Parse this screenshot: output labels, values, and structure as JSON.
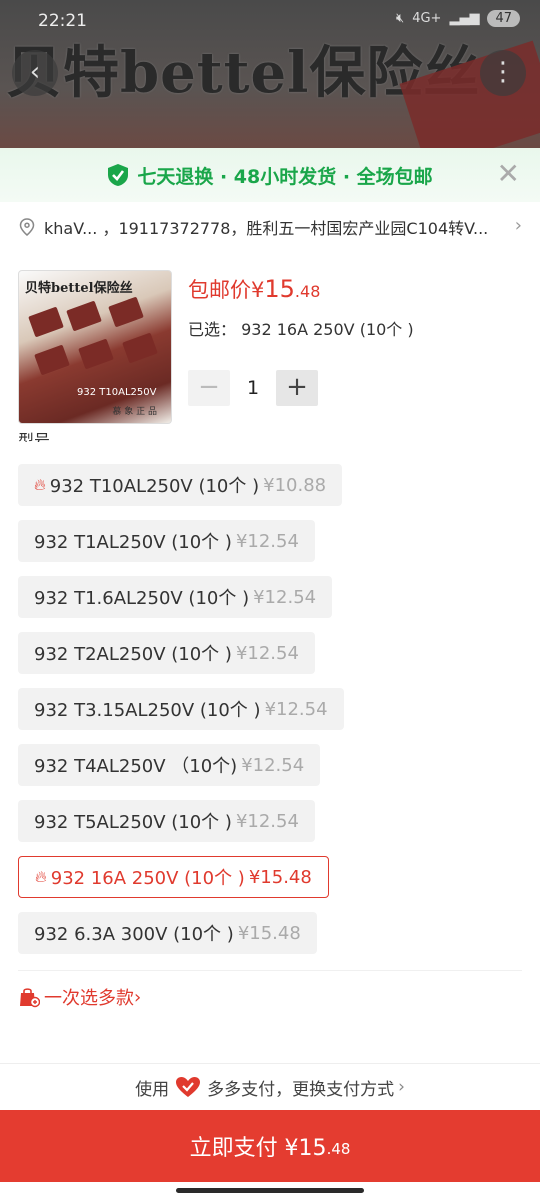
{
  "status_bar": {
    "time": "22:21",
    "signal": "4G+",
    "battery": "47"
  },
  "background": {
    "banner_text": "贝特bettel保险丝"
  },
  "promo": {
    "text": "七天退换 · 48小时发货 · 全场包邮",
    "color": "#1aa64a"
  },
  "address": {
    "text": "khaV... ，19117372778，胜利五一村国宏产业园C104转V..."
  },
  "product": {
    "thumb_title": "贝特bettel保险丝",
    "thumb_label": "932 T10AL250V",
    "thumb_sub": "慕 象 正 品",
    "price_prefix": "包邮价",
    "price_symbol": "¥",
    "price_int": "15",
    "price_dec": ".48",
    "selected_prefix": "已选：",
    "selected_value": "932 16A 250V (10个 )",
    "quantity": "1",
    "minus": "−",
    "plus": "+"
  },
  "section_label": "型号",
  "options": [
    {
      "name": "932 T10AL250V (10个 )",
      "price": "¥10.88",
      "hot": true,
      "selected": false
    },
    {
      "name": "932 T1AL250V (10个 )",
      "price": "¥12.54",
      "hot": false,
      "selected": false
    },
    {
      "name": "932 T1.6AL250V (10个 )",
      "price": "¥12.54",
      "hot": false,
      "selected": false
    },
    {
      "name": "932 T2AL250V (10个 )",
      "price": "¥12.54",
      "hot": false,
      "selected": false
    },
    {
      "name": "932 T3.15AL250V (10个 )",
      "price": "¥12.54",
      "hot": false,
      "selected": false
    },
    {
      "name": "932 T4AL250V （10个)",
      "price": "¥12.54",
      "hot": false,
      "selected": false
    },
    {
      "name": "932 T5AL250V (10个 )",
      "price": "¥12.54",
      "hot": false,
      "selected": false
    },
    {
      "name": "932 16A 250V (10个 )",
      "price": "¥15.48",
      "hot": true,
      "selected": true
    },
    {
      "name": "932 6.3A 300V (10个 )",
      "price": "¥15.48",
      "hot": false,
      "selected": false
    }
  ],
  "multi_select": {
    "label": "一次选多款",
    "chevron": "›"
  },
  "payment": {
    "prefix": "使用",
    "method": "多多支付，更换支付方式",
    "chevron": "›"
  },
  "pay_button": {
    "label": "立即支付 ¥15",
    "decimal": ".48"
  },
  "colors": {
    "accent": "#e43c30",
    "green": "#1aa64a"
  }
}
